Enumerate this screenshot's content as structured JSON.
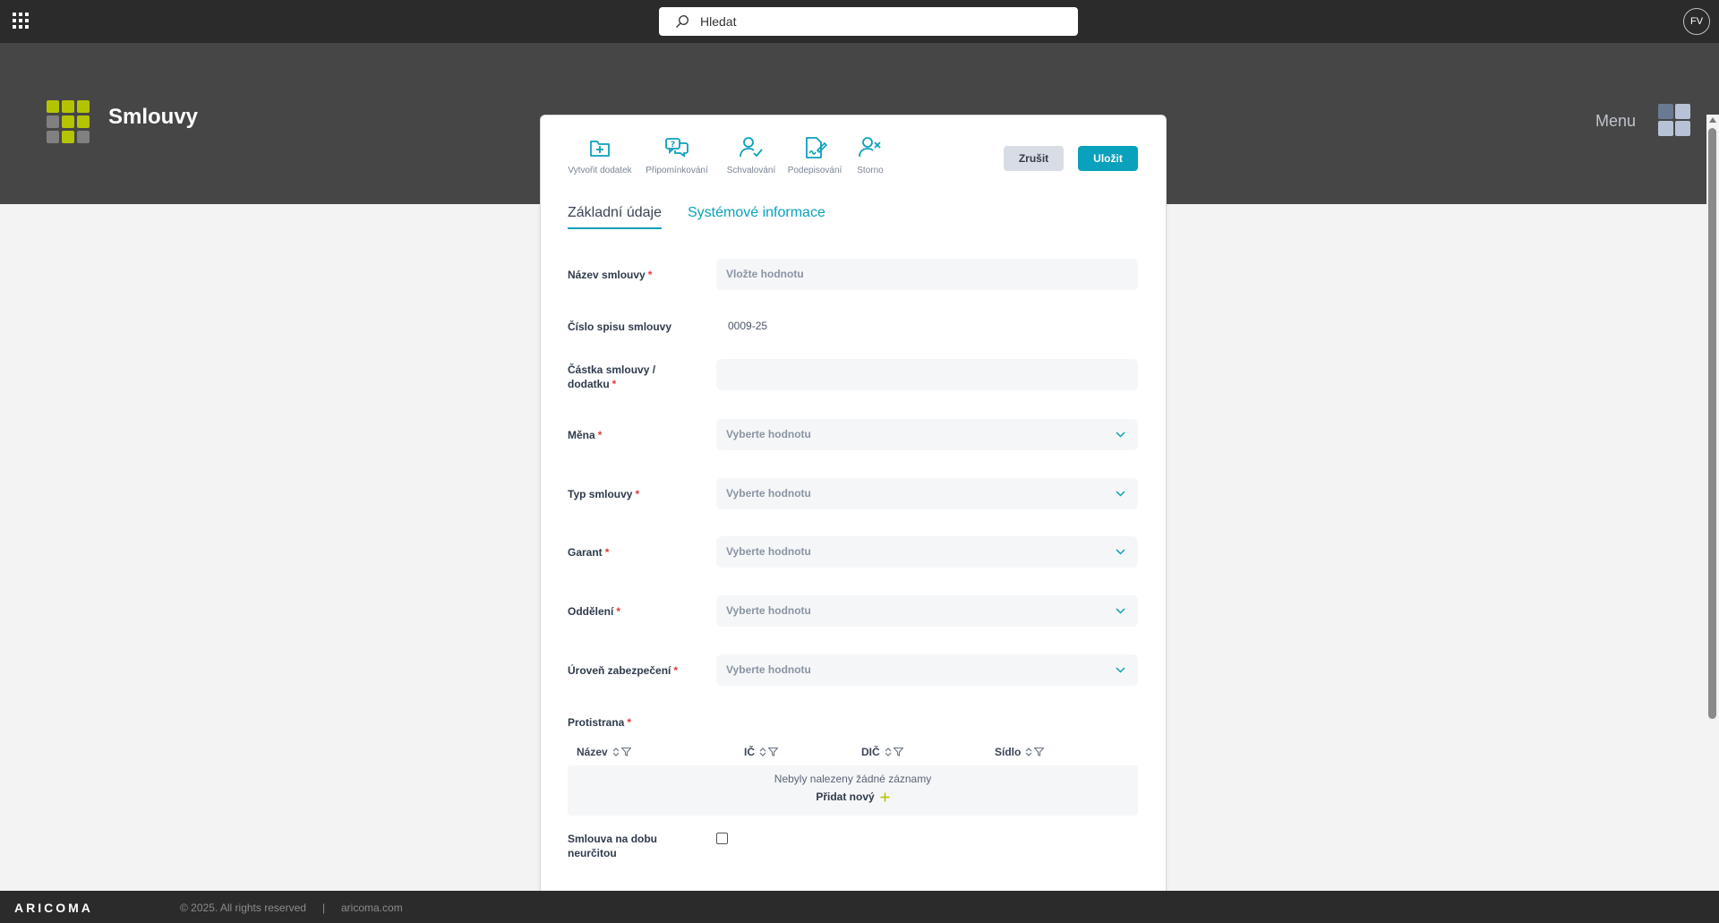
{
  "topbar": {
    "search_placeholder": "Hledat",
    "avatar_initials": "FV"
  },
  "header": {
    "app_title": "Smlouvy",
    "menu_label": "Menu",
    "logo_colors": [
      "#b5c400",
      "#b5c400",
      "#b5c400",
      "#808080",
      "#b5c400",
      "#b5c400",
      "#808080",
      "#b5c400",
      "#808080"
    ],
    "menu_icon_colors": [
      "#6b7a93",
      "#b7c2d6",
      "#b7c2d6",
      "#b7c2d6"
    ]
  },
  "toolbar": {
    "actions": [
      {
        "label": "Vytvořit dodatek",
        "icon": "folder-plus-icon"
      },
      {
        "label": "Připomínkování",
        "icon": "comments-question-icon"
      },
      {
        "label": "Schvalování",
        "icon": "user-check-icon"
      },
      {
        "label": "Podepisování",
        "icon": "document-sign-icon"
      },
      {
        "label": "Storno",
        "icon": "user-x-icon"
      }
    ],
    "cancel_label": "Zrušit",
    "save_label": "Uložit"
  },
  "tabs": {
    "basic": "Základní údaje",
    "system": "Systémové informace"
  },
  "form": {
    "contract_name": {
      "label": "Název smlouvy",
      "required": "*",
      "placeholder": "Vložte hodnotu"
    },
    "file_number": {
      "label": "Číslo spisu smlouvy",
      "value": "0009-25"
    },
    "amount": {
      "label_line1": "Částka smlouvy /",
      "label_line2": "dodatku",
      "required": "*"
    },
    "currency": {
      "label": "Měna",
      "required": "*",
      "placeholder": "Vyberte hodnotu"
    },
    "contract_type": {
      "label": "Typ smlouvy",
      "required": "*",
      "placeholder": "Vyberte hodnotu"
    },
    "guarantor": {
      "label": "Garant",
      "required": "*",
      "placeholder": "Vyberte hodnotu"
    },
    "department": {
      "label": "Oddělení",
      "required": "*",
      "placeholder": "Vyberte hodnotu"
    },
    "security_level": {
      "label": "Úroveň zabezpečení",
      "required": "*",
      "placeholder": "Vyberte hodnotu"
    },
    "counterparty": {
      "label": "Protistrana",
      "required": "*",
      "columns": [
        "Název",
        "IČ",
        "DIČ",
        "Sídlo"
      ],
      "empty_message": "Nebyly nalezeny žádné záznamy",
      "add_new": "Přidat nový"
    },
    "indefinite": {
      "label_line1": "Smlouva na dobu",
      "label_line2": "neurčitou",
      "checked": false
    }
  },
  "footer": {
    "brand": "ARICOMA",
    "copyright": "© 2025. All rights reserved",
    "separator": "|",
    "site": "aricoma.com"
  },
  "colors": {
    "accent": "#0aa1bd",
    "required": "#e23a3a",
    "topbar": "#2b2b2b",
    "band": "#464646"
  }
}
